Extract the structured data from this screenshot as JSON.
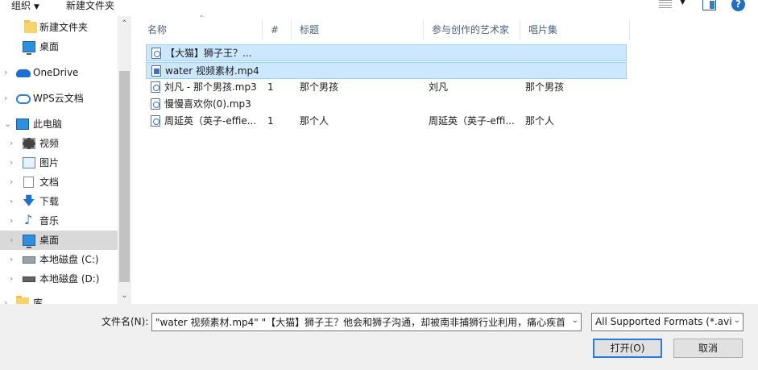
{
  "toolbar": {
    "organize_label": "组织",
    "new_folder_label": "新建文件夹"
  },
  "nav": {
    "items": [
      {
        "label": "新建文件夹",
        "icon": "folder-icon"
      },
      {
        "label": "桌面",
        "icon": "desktop-icon"
      },
      {
        "label": "OneDrive",
        "icon": "onedrive-cloud-icon"
      },
      {
        "label": "WPS云文档",
        "icon": "wps-cloud-icon"
      },
      {
        "label": "此电脑",
        "icon": "computer-icon"
      },
      {
        "label": "视频",
        "icon": "video-folder-icon"
      },
      {
        "label": "图片",
        "icon": "pictures-folder-icon"
      },
      {
        "label": "文档",
        "icon": "documents-folder-icon"
      },
      {
        "label": "下载",
        "icon": "download-arrow-icon"
      },
      {
        "label": "音乐",
        "icon": "music-note-icon"
      },
      {
        "label": "桌面",
        "icon": "desktop-icon"
      },
      {
        "label": "本地磁盘 (C:)",
        "icon": "drive-c-icon"
      },
      {
        "label": "本地磁盘 (D:)",
        "icon": "drive-d-icon"
      },
      {
        "label": "库",
        "icon": "library-icon"
      }
    ]
  },
  "columns": [
    "名称",
    "#",
    "标题",
    "参与创作的艺术家",
    "唱片集"
  ],
  "files": [
    {
      "name": "【大猫】狮子王？...",
      "num": "",
      "title": "",
      "artist": "",
      "album": "",
      "selected": true
    },
    {
      "name": "water 视频素材.mp4",
      "num": "",
      "title": "",
      "artist": "",
      "album": "",
      "selected": true
    },
    {
      "name": "刘凡 - 那个男孩.mp3",
      "num": "1",
      "title": "那个男孩",
      "artist": "刘凡",
      "album": "那个男孩",
      "selected": false
    },
    {
      "name": "慢慢喜欢你(0).mp3",
      "num": "",
      "title": "",
      "artist": "",
      "album": "",
      "selected": false
    },
    {
      "name": "周延英（英子-effie...",
      "num": "1",
      "title": "那个人",
      "artist": "周延英（英子-effi...",
      "album": "那个人",
      "selected": false
    }
  ],
  "bottom": {
    "filename_label": "文件名(N):",
    "filename_value": "\"water 视频素材.mp4\" \"【大猫】狮子王？他会和狮子沟通，却被南非捕狮行业利用，痛心疾首的",
    "filetype_value": "All Supported Formats (*.avi",
    "open_label": "打开(O)",
    "cancel_label": "取消"
  },
  "colors": {
    "selection_bg": "#cce8ff",
    "selection_border": "#99d1ff",
    "nav_selected_bg": "#d9d9d9",
    "accent": "#2a7ad7"
  }
}
